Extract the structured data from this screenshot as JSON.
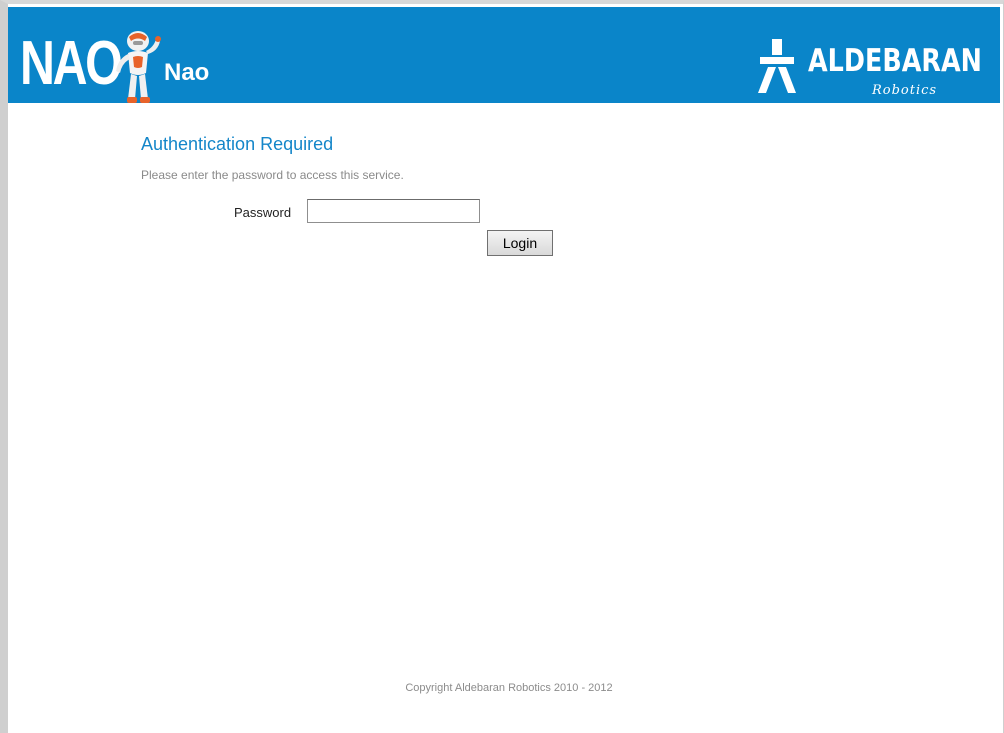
{
  "header": {
    "logo_text": "NAO",
    "robot_name": "Nao",
    "brand_name": "ALDEBARAN",
    "brand_sub": "Robotics",
    "background_color": "#0a85c9"
  },
  "auth": {
    "title": "Authentication Required",
    "description": "Please enter the password to access this service.",
    "password_label": "Password",
    "password_value": "",
    "login_label": "Login"
  },
  "footer": {
    "copyright": "Copyright Aldebaran Robotics 2010 - 2012"
  },
  "colors": {
    "title_blue": "#1486c9",
    "muted_text": "#8a8a8a"
  }
}
